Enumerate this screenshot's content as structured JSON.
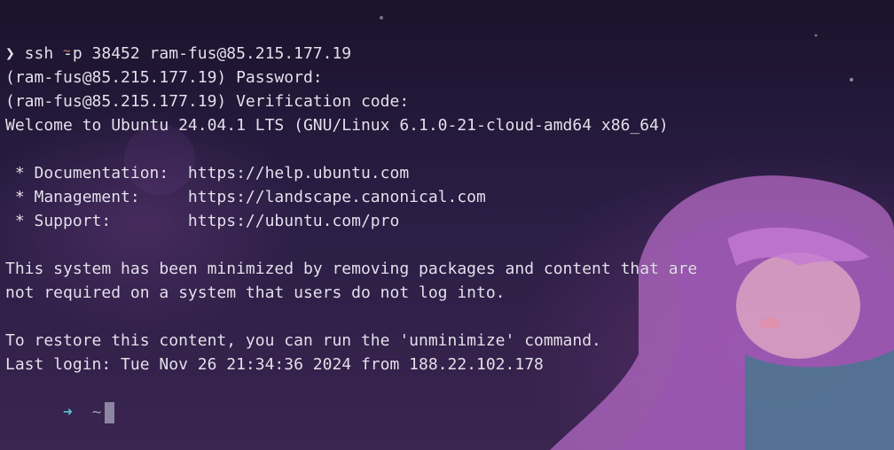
{
  "terminal": {
    "top_tilde": "~",
    "lines": [
      {
        "prefix": "❯",
        "text": " ssh -p 38452 ram-fus@85.215.177.19"
      },
      {
        "text": "(ram-fus@85.215.177.19) Password:"
      },
      {
        "text": "(ram-fus@85.215.177.19) Verification code:"
      },
      {
        "text": "Welcome to Ubuntu 24.04.1 LTS (GNU/Linux 6.1.0-21-cloud-amd64 x86_64)"
      },
      {
        "text": ""
      },
      {
        "text": " * Documentation:  https://help.ubuntu.com"
      },
      {
        "text": " * Management:     https://landscape.canonical.com"
      },
      {
        "text": " * Support:        https://ubuntu.com/pro"
      },
      {
        "text": ""
      },
      {
        "text": "This system has been minimized by removing packages and content that are"
      },
      {
        "text": "not required on a system that users do not log into."
      },
      {
        "text": ""
      },
      {
        "text": "To restore this content, you can run the 'unminimize' command."
      },
      {
        "text": "Last login: Tue Nov 26 21:34:36 2024 from 188.22.102.178"
      }
    ],
    "prompt": {
      "arrow": "➜",
      "dir": "~"
    }
  },
  "colors": {
    "arrow": "#5ec3d4",
    "text": "#e6e0ee",
    "top_tilde": "#d98a7a"
  }
}
